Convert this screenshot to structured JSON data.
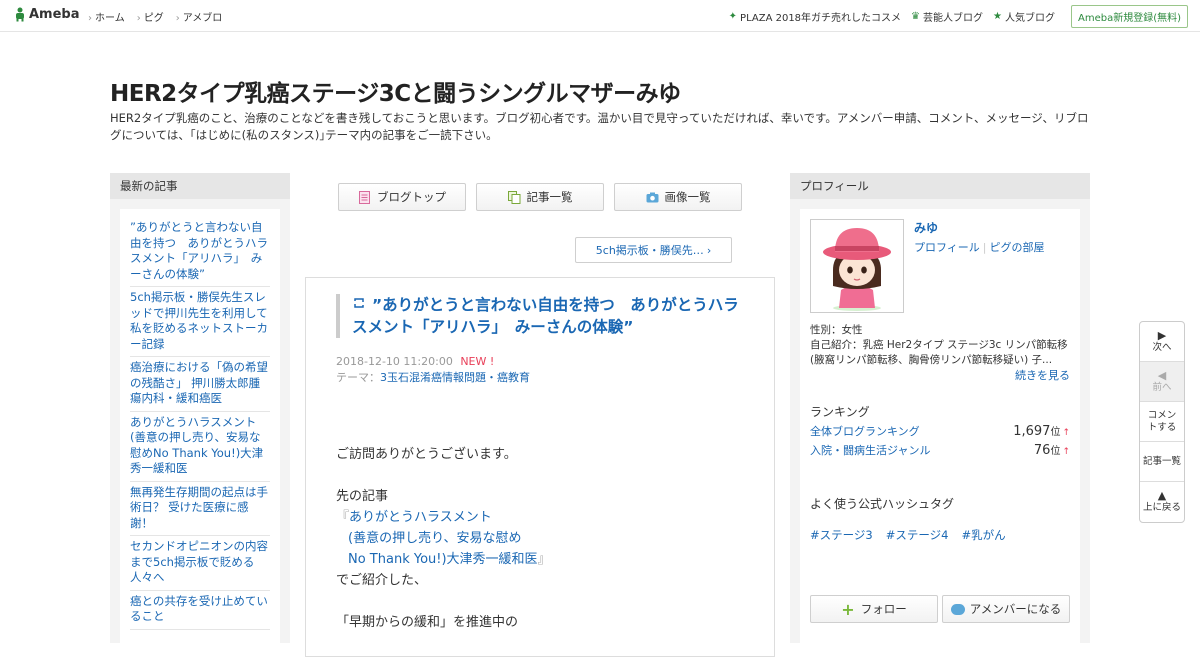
{
  "topbar": {
    "logo_text": "Ameba",
    "nav": [
      "ホーム",
      "ピグ",
      "アメブロ"
    ],
    "links": [
      {
        "label": "PLAZA 2018年ガチ売れしたコスメ",
        "icon": "sparkle-icon"
      },
      {
        "label": "芸能人ブログ",
        "icon": "crown-icon"
      },
      {
        "label": "人気ブログ",
        "icon": "star-icon"
      }
    ],
    "register_label": "Ameba新規登録(無料)"
  },
  "header": {
    "title": "HER2タイプ乳癌ステージ3Cと闘うシングルマザーみゆ",
    "description": "HER2タイプ乳癌のこと、治療のことなどを書き残しておこうと思います。ブログ初心者です。温かい目で見守っていただければ、幸いです。アメンバー申請、コメント、メッセージ、リブログについては、｢はじめに(私のスタンス)｣テーマ内の記事をご一読下さい。"
  },
  "left_sidebar": {
    "heading": "最新の記事",
    "items": [
      "”ありがとうと言わない自由を持つ　ありがとうハラスメント「アリハラ」　みーさんの体験”",
      "5ch掲示板・勝俣先生スレッドで押川先生を利用して私を貶めるネットストーカー記録",
      "癌治療における「偽の希望の残酷さ」 押川勝太郎腫瘍内科・緩和癌医",
      "ありがとうハラスメント(善意の押し売り、安易な慰めNo Thank You!)大津秀一緩和医",
      "無再発生存期間の起点は手術日？ 受けた医療に感謝！",
      "セカンドオピニオンの内容まで5ch掲示板で貶める人々へ",
      "癌との共存を受け止めていること"
    ]
  },
  "center": {
    "buttons": [
      {
        "label": "ブログトップ",
        "icon": "document-icon"
      },
      {
        "label": "記事一覧",
        "icon": "copy-icon"
      },
      {
        "label": "画像一覧",
        "icon": "camera-icon"
      }
    ],
    "prev_link": "5ch掲示板・勝俣先…",
    "article": {
      "title": "”ありがとうと言わない自由を持つ　ありがとうハラスメント「アリハラ」　みーさんの体験”",
      "date": "2018-12-10 11:20:00",
      "new_badge": "NEW !",
      "theme_label": "テーマ：",
      "theme": "3玉石混淆癌情報問題・癌教育",
      "body": {
        "greeting": "ご訪問ありがとうございます。",
        "prev_intro": "先の記事",
        "link_open": "『",
        "link_line1": "ありがとうハラスメント",
        "link_line2": "(善意の押し売り、安易な慰め",
        "link_line3": "No Thank You!)大津秀一緩和医",
        "link_close": "』",
        "intro_end": "でご紹介した、",
        "last_line": "「早期からの緩和」を推進中の"
      }
    }
  },
  "right_sidebar": {
    "heading": "プロフィール",
    "name": "みゆ",
    "profile_link": "プロフィール",
    "pig_link": "ピグの部屋",
    "gender": "性別：女性",
    "intro": "自己紹介：乳癌 Her2タイプ ステージ3c リンパ節転移 (腋窩リンパ節転移、胸骨傍リンパ節転移疑い) 子...",
    "more_label": "続きを見る",
    "ranking_heading": "ランキング",
    "rankings": [
      {
        "label": "全体ブログランキング",
        "value": "1,697",
        "unit": "位",
        "trend": "↑"
      },
      {
        "label": "入院・闘病生活ジャンル",
        "value": "76",
        "unit": "位",
        "trend": "↑"
      }
    ],
    "hashtag_heading": "よく使う公式ハッシュタグ",
    "hashtags": [
      "#ステージ3",
      "#ステージ4",
      "#乳がん"
    ],
    "follow_label": "フォロー",
    "amember_label": "アメンバーになる"
  },
  "float_nav": {
    "next": "次へ",
    "prev": "前へ",
    "comment": "コメントする",
    "list": "記事一覧",
    "top": "上に戻る"
  },
  "colors": {
    "link": "#1a67b3",
    "ameba_green": "#2d8a3e",
    "new_badge": "#e83e57",
    "sidebar_bg": "#f3f3f3"
  }
}
